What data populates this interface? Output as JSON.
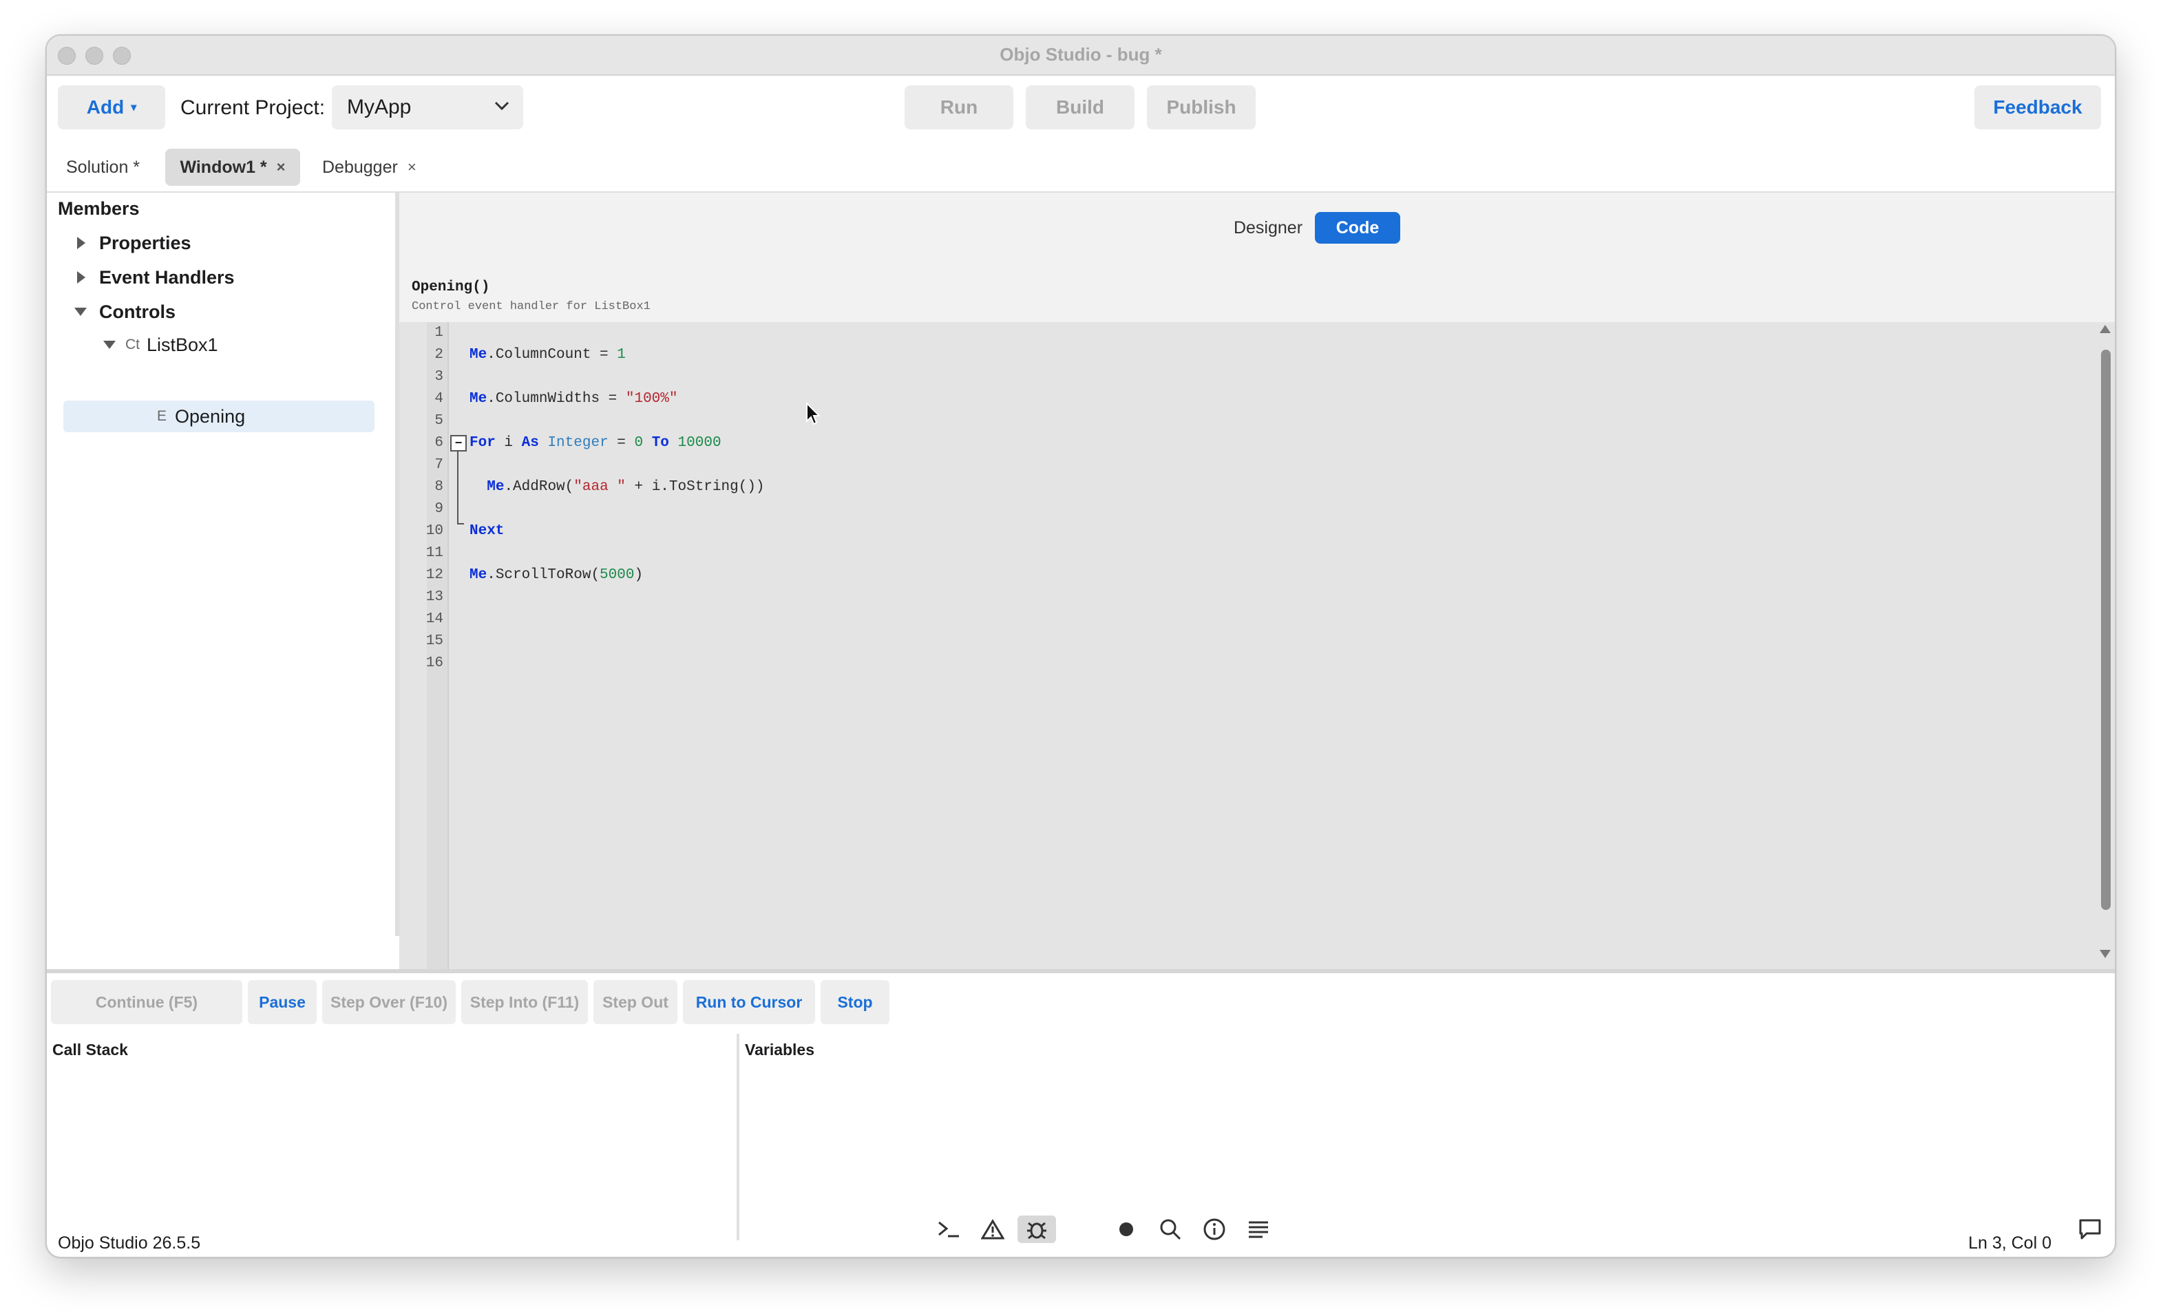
{
  "window": {
    "title": "Objo Studio - bug *"
  },
  "toolbar": {
    "add_label": "Add",
    "add_arrow": "▾",
    "current_project_label": "Current Project:",
    "project_select_value": "MyApp",
    "run_label": "Run",
    "build_label": "Build",
    "publish_label": "Publish",
    "feedback_label": "Feedback"
  },
  "tabs": [
    {
      "label": "Solution *",
      "closable": false
    },
    {
      "label": "Window1 *",
      "closable": true,
      "active": true
    },
    {
      "label": "Debugger",
      "closable": true
    }
  ],
  "tab_close_glyph": "×",
  "sidebar": {
    "header": "Members",
    "items": [
      {
        "label": "Properties"
      },
      {
        "label": "Event Handlers"
      },
      {
        "label": "Controls"
      },
      {
        "prefix": "Ct",
        "label": "ListBox1"
      },
      {
        "prefix": "E",
        "label": "Opening"
      }
    ]
  },
  "editor": {
    "designer_label": "Designer",
    "code_label": "Code",
    "method_signature": "Opening()",
    "method_description": "Control event handler for ListBox1",
    "line_numbers": [
      "1",
      "2",
      "3",
      "4",
      "5",
      "6",
      "7",
      "8",
      "9",
      "10",
      "11",
      "12",
      "13",
      "14",
      "15",
      "16"
    ],
    "code_lines": [
      "",
      "Me.ColumnCount = 1",
      "",
      "Me.ColumnWidths = \"100%\"",
      "",
      "For i As Integer = 0 To 10000",
      "",
      "  Me.AddRow(\"aaa \" + i.ToString())",
      "",
      "Next",
      "",
      "Me.ScrollToRow(5000)",
      "",
      "",
      "",
      ""
    ],
    "fold_glyph": "−"
  },
  "debugger": {
    "buttons": [
      {
        "label": "Continue (F5)",
        "enabled": false
      },
      {
        "label": "Pause",
        "enabled": true
      },
      {
        "label": "Step Over (F10)",
        "enabled": false
      },
      {
        "label": "Step Into (F11)",
        "enabled": false
      },
      {
        "label": "Step Out",
        "enabled": false
      },
      {
        "label": "Run to Cursor",
        "enabled": true
      },
      {
        "label": "Stop",
        "enabled": true
      }
    ],
    "call_stack_title": "Call Stack",
    "variables_title": "Variables"
  },
  "status": {
    "version": "Objo Studio 26.5.5",
    "cursor_position": "Ln 3, Col 0",
    "icons": [
      "terminal-icon",
      "warning-icon",
      "bug-icon",
      "record-icon",
      "search-icon",
      "info-icon",
      "list-icon",
      "comment-icon"
    ]
  },
  "colors": {
    "accent": "#1a6fd8",
    "keyword": "#0a2fd8",
    "string": "#b3262e",
    "number": "#1a8a4a",
    "type": "#2f7dbd"
  }
}
